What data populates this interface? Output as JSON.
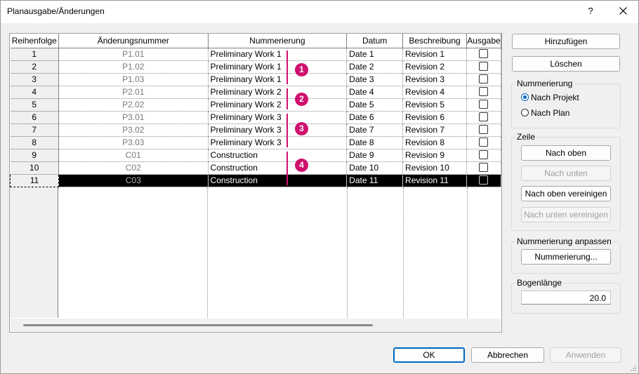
{
  "window": {
    "title": "Planausgabe/Änderungen",
    "help_label": "?"
  },
  "columns": [
    "Reihenfolge",
    "Änderungsnummer",
    "Nummerierung",
    "Datum",
    "Beschreibung",
    "Ausgabe"
  ],
  "rows": [
    {
      "order": "1",
      "number": "P1.01",
      "numbering": "Preliminary Work 1",
      "date": "Date 1",
      "description": "Revision 1",
      "issued": false
    },
    {
      "order": "2",
      "number": "P1.02",
      "numbering": "Preliminary Work 1",
      "date": "Date 2",
      "description": "Revision 2",
      "issued": false
    },
    {
      "order": "3",
      "number": "P1.03",
      "numbering": "Preliminary Work 1",
      "date": "Date 3",
      "description": "Revision 3",
      "issued": false
    },
    {
      "order": "4",
      "number": "P2.01",
      "numbering": "Preliminary Work 2",
      "date": "Date 4",
      "description": "Revision 4",
      "issued": false
    },
    {
      "order": "5",
      "number": "P2.02",
      "numbering": "Preliminary Work 2",
      "date": "Date 5",
      "description": "Revision 5",
      "issued": false
    },
    {
      "order": "6",
      "number": "P3.01",
      "numbering": "Preliminary Work 3",
      "date": "Date 6",
      "description": "Revision 6",
      "issued": false
    },
    {
      "order": "7",
      "number": "P3.02",
      "numbering": "Preliminary Work 3",
      "date": "Date 7",
      "description": "Revision 7",
      "issued": false
    },
    {
      "order": "8",
      "number": "P3.03",
      "numbering": "Preliminary Work 3",
      "date": "Date 8",
      "description": "Revision 8",
      "issued": false
    },
    {
      "order": "9",
      "number": "C01",
      "numbering": "Construction",
      "date": "Date 9",
      "description": "Revision 9",
      "issued": false
    },
    {
      "order": "10",
      "number": "C02",
      "numbering": "Construction",
      "date": "Date 10",
      "description": "Revision 10",
      "issued": false
    },
    {
      "order": "11",
      "number": "C03",
      "numbering": "Construction",
      "date": "Date 11",
      "description": "Revision 11",
      "issued": false
    }
  ],
  "selected_row": 11,
  "markers": [
    "1",
    "2",
    "3",
    "4"
  ],
  "colors": {
    "marker": "#d0106e",
    "selection": "#000000",
    "accent": "#0067c0"
  },
  "side": {
    "add_label": "Hinzufügen",
    "delete_label": "Löschen",
    "numbering_group": {
      "label": "Nummerierung",
      "options": [
        "Nach Projekt",
        "Nach Plan"
      ],
      "selected": "Nach Projekt"
    },
    "row_group": {
      "label": "Zeile",
      "move_up": "Nach oben",
      "move_down": "Nach unten",
      "merge_up": "Nach oben vereinigen",
      "merge_down": "Nach unten vereinigen"
    },
    "custom_group": {
      "label": "Nummerierung anpassen",
      "button": "Nummerierung..."
    },
    "arc_group": {
      "label": "Bogenlänge",
      "value": "20.0"
    }
  },
  "footer": {
    "ok": "OK",
    "cancel": "Abbrechen",
    "apply": "Anwenden"
  }
}
